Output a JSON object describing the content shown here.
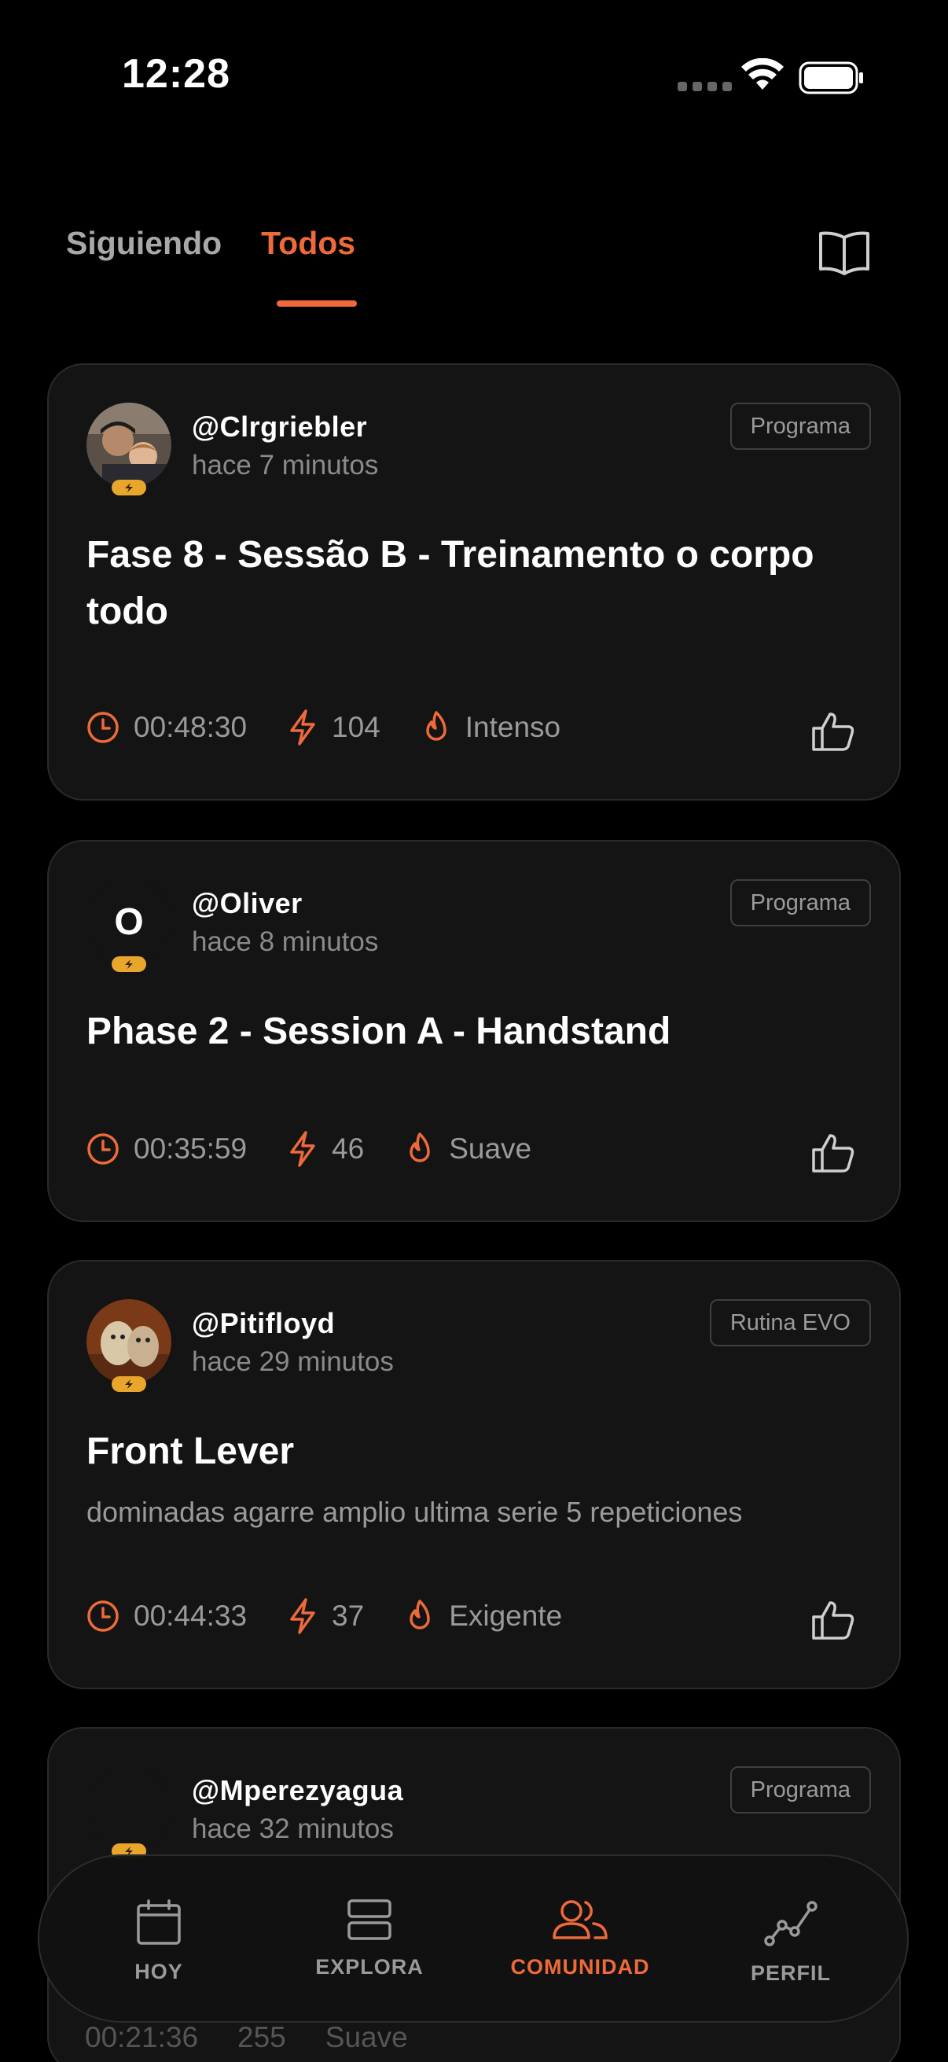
{
  "status_bar": {
    "time": "12:28"
  },
  "tabs": [
    {
      "label": "Siguiendo",
      "active": false
    },
    {
      "label": "Todos",
      "active": true
    }
  ],
  "colors": {
    "accent": "#ee6a3a",
    "badge": "#e9a62c",
    "card_bg": "#141414"
  },
  "posts": [
    {
      "username": "@Clrgriebler",
      "time_ago": "hace 7 minutos",
      "tag": "Programa",
      "title": "Fase 8 - Sessão B - Treinamento o corpo todo",
      "description": "",
      "duration": "00:48:30",
      "energy": "104",
      "intensity": "Intenso"
    },
    {
      "username": "@Oliver",
      "avatar_letter": "O",
      "time_ago": "hace 8 minutos",
      "tag": "Programa",
      "title": "Phase 2 - Session A - Handstand",
      "description": "",
      "duration": "00:35:59",
      "energy": "46",
      "intensity": "Suave"
    },
    {
      "username": "@Pitifloyd",
      "time_ago": "hace 29 minutos",
      "tag": "Rutina EVO",
      "title": "Front Lever",
      "description": "dominadas agarre amplio ultima serie 5 repeticiones",
      "duration": "00:44:33",
      "energy": "37",
      "intensity": "Exigente"
    },
    {
      "username": "@Mperezyagua",
      "time_ago": "hace 32 minutos",
      "tag": "Programa",
      "duration": "00:21:36",
      "energy": "255",
      "intensity": "Suave"
    }
  ],
  "nav": [
    {
      "label": "HOY",
      "icon": "calendar-icon"
    },
    {
      "label": "EXPLORA",
      "icon": "stack-icon"
    },
    {
      "label": "COMUNIDAD",
      "icon": "people-icon",
      "active": true
    },
    {
      "label": "PERFIL",
      "icon": "chart-line-icon"
    }
  ]
}
